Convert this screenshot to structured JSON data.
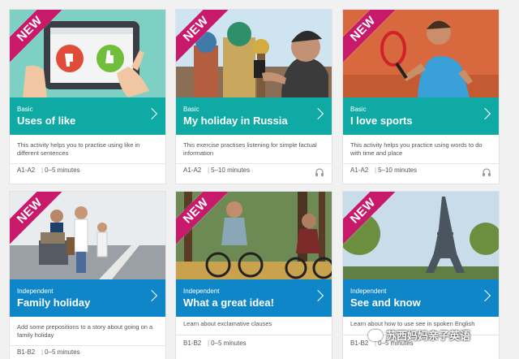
{
  "colors": {
    "badge": "#c8196b",
    "basic_band": "#10aaa5",
    "independent_band": "#0e86c7"
  },
  "cards": [
    {
      "badge": "NEW",
      "level": "Basic",
      "title": "Uses of like",
      "description": "This activity helps you to practise using like in different sentences",
      "cefr": "A1-A2",
      "duration": "0–5 minutes",
      "audio_icon": ""
    },
    {
      "badge": "NEW",
      "level": "Basic",
      "title": "My holiday in Russia",
      "description": "This exercise practises listening for simple factual information",
      "cefr": "A1-A2",
      "duration": "5–10 minutes",
      "audio_icon": "headphones-icon"
    },
    {
      "badge": "NEW",
      "level": "Basic",
      "title": "I love sports",
      "description": "This activity helps you practice using words to do with time and place",
      "cefr": "A1-A2",
      "duration": "5–10 minutes",
      "audio_icon": "headphones-icon"
    },
    {
      "badge": "NEW",
      "level": "Independent",
      "title": "Family holiday",
      "description": "Add some prepositions to a story about going on a family holiday",
      "cefr": "B1-B2",
      "duration": "0–5 minutes",
      "audio_icon": ""
    },
    {
      "badge": "NEW",
      "level": "Independent",
      "title": "What a great idea!",
      "description": "Learn about exclamative clauses",
      "cefr": "B1-B2",
      "duration": "0–5 minutes",
      "audio_icon": ""
    },
    {
      "badge": "NEW",
      "level": "Independent",
      "title": "See and know",
      "description": "Learn about how to use see in spoken English",
      "cefr": "B1-B2",
      "duration": "0–5 minutes",
      "audio_icon": ""
    }
  ],
  "watermark": {
    "text": "苏西妈妈亲子英语"
  }
}
